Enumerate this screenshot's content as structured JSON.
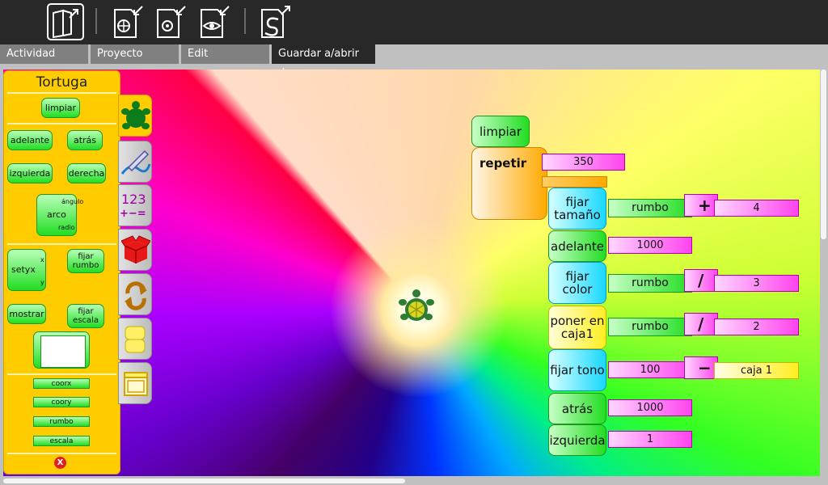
{
  "toolbar": {
    "icons": [
      "activity-icon",
      "view-source-icon",
      "save-web-icon",
      "save-image-icon",
      "save-svg-icon",
      "export-logo-icon"
    ]
  },
  "tabs": [
    {
      "label": "Actividad",
      "active": false
    },
    {
      "label": "Proyecto",
      "active": false
    },
    {
      "label": "Edit",
      "active": false
    },
    {
      "label": "Guardar a/abrir de",
      "active": true
    }
  ],
  "palette": {
    "title": "Tortuga",
    "blocks": {
      "limpiar": "limpiar",
      "adelante": "adelante",
      "atras": "atrás",
      "izquierda": "izquierda",
      "derecha": "derecha",
      "arco": "arco",
      "arco_angulo": "ángulo",
      "arco_radio": "radio",
      "setxy": "setyx",
      "setxy_x": "x",
      "setxy_y": "y",
      "fijar_rumbo": "fijar rumbo",
      "mostrar": "mostrar",
      "fijar_escala": "fijar escala",
      "coorx": "coorx",
      "coory": "coory",
      "rumbo": "rumbo",
      "escala": "escala"
    },
    "close_label": "X"
  },
  "side_tabs": [
    {
      "name": "turtle-palette-tab",
      "icon": "turtle-icon",
      "active": true
    },
    {
      "name": "pen-palette-tab",
      "icon": "pen-icon",
      "active": false
    },
    {
      "name": "numbers-palette-tab",
      "icon": "numbers-icon",
      "label_top": "123",
      "label_bottom": "+−=",
      "active": false
    },
    {
      "name": "blocks-palette-tab",
      "icon": "box-icon",
      "active": false
    },
    {
      "name": "flow-palette-tab",
      "icon": "cycle-icon",
      "active": false
    },
    {
      "name": "boxes-palette-tab",
      "icon": "stacked-blocks-icon",
      "active": false
    },
    {
      "name": "media-palette-tab",
      "icon": "window-icon",
      "active": false
    }
  ],
  "program": {
    "limpiar": "limpiar",
    "repetir": "repetir",
    "repetir_count": "350",
    "fijar_tamano": "fijar tamaño",
    "rumbo_1": "rumbo",
    "op_plus": "+",
    "plus_value": "4",
    "adelante": "adelante",
    "adelante_value": "1000",
    "fijar_color": "fijar color",
    "rumbo_2": "rumbo",
    "op_div_1": "/",
    "div_value_1": "3",
    "poner_en_caja": "poner en caja1",
    "rumbo_3": "rumbo",
    "op_div_2": "/",
    "div_value_2": "2",
    "fijar_tono": "fijar tono",
    "tono_value": "100",
    "op_minus": "−",
    "caja_label": "caja 1",
    "atras": "atrás",
    "atras_value": "1000",
    "izquierda": "izquierda",
    "izquierda_value": "1"
  }
}
